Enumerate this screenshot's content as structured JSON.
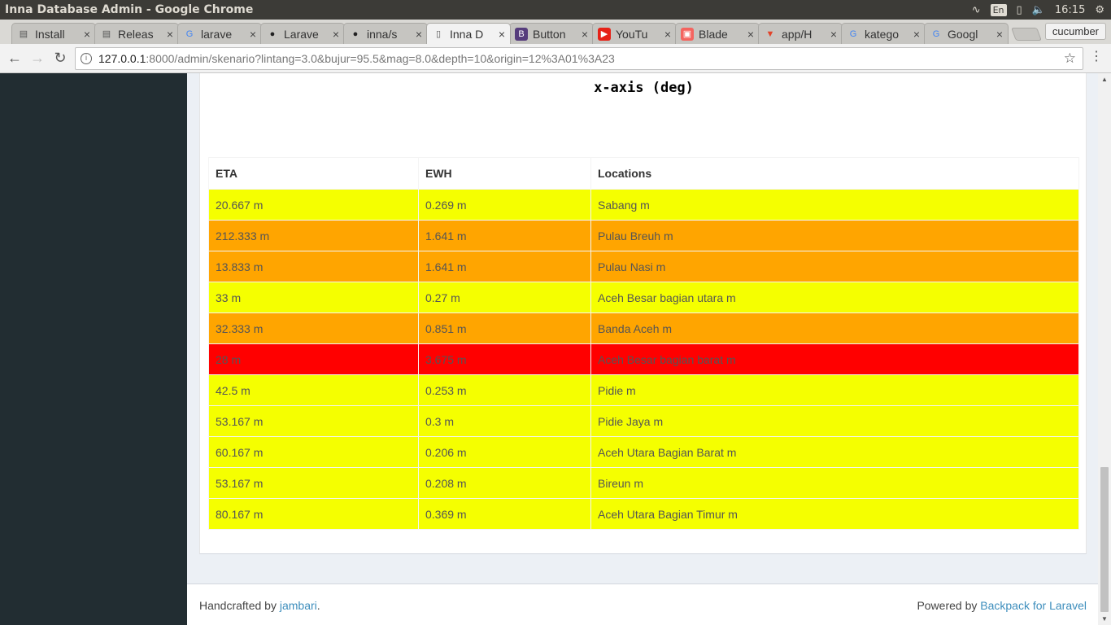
{
  "window": {
    "title": "Inna Database Admin - Google Chrome",
    "tray": {
      "lang": "En",
      "time": "16:15"
    }
  },
  "tabs": [
    {
      "label": "Install",
      "icon": "doc-icon",
      "active": false
    },
    {
      "label": "Releas",
      "icon": "doc-icon",
      "active": false
    },
    {
      "label": "larave",
      "icon": "google-icon",
      "active": false
    },
    {
      "label": "Larave",
      "icon": "github-icon",
      "active": false
    },
    {
      "label": "inna/s",
      "icon": "github-icon",
      "active": false
    },
    {
      "label": "Inna D",
      "icon": "page-icon",
      "active": true
    },
    {
      "label": "Button",
      "icon": "bootstrap-icon",
      "active": false
    },
    {
      "label": "YouTu",
      "icon": "youtube-icon",
      "active": false
    },
    {
      "label": "Blade",
      "icon": "laravel-icon",
      "active": false
    },
    {
      "label": "app/H",
      "icon": "gitlab-icon",
      "active": false
    },
    {
      "label": "katego",
      "icon": "google-icon",
      "active": false
    },
    {
      "label": "Googl",
      "icon": "google-icon",
      "active": false
    }
  ],
  "profile": "cucumber",
  "address": {
    "host": "127.0.0.1",
    "rest": ":8000/admin/skenario?lintang=3.0&bujur=95.5&mag=8.0&depth=10&origin=12%3A01%3A23"
  },
  "chart_data": {
    "type": "table",
    "xlabel": "x-axis (deg)",
    "columns": [
      "ETA",
      "EWH",
      "Locations"
    ],
    "rows": [
      {
        "eta": "20.667 m",
        "ewh": "0.269 m",
        "location": "Sabang m",
        "level": "yellow"
      },
      {
        "eta": "212.333 m",
        "ewh": "1.641 m",
        "location": "Pulau Breuh m",
        "level": "orange"
      },
      {
        "eta": "13.833 m",
        "ewh": "1.641 m",
        "location": "Pulau Nasi m",
        "level": "orange"
      },
      {
        "eta": "33 m",
        "ewh": "0.27 m",
        "location": "Aceh Besar bagian utara m",
        "level": "yellow"
      },
      {
        "eta": "32.333 m",
        "ewh": "0.851 m",
        "location": "Banda Aceh m",
        "level": "orange"
      },
      {
        "eta": "28 m",
        "ewh": "3.675 m",
        "location": "Aceh Besar bagian barat m",
        "level": "red"
      },
      {
        "eta": "42.5 m",
        "ewh": "0.253 m",
        "location": "Pidie m",
        "level": "yellow"
      },
      {
        "eta": "53.167 m",
        "ewh": "0.3 m",
        "location": "Pidie Jaya m",
        "level": "yellow"
      },
      {
        "eta": "60.167 m",
        "ewh": "0.206 m",
        "location": "Aceh Utara Bagian Barat m",
        "level": "yellow"
      },
      {
        "eta": "53.167 m",
        "ewh": "0.208 m",
        "location": "Bireun m",
        "level": "yellow"
      },
      {
        "eta": "80.167 m",
        "ewh": "0.369 m",
        "location": "Aceh Utara Bagian Timur m",
        "level": "yellow"
      }
    ]
  },
  "level_colors": {
    "yellow": "#f5ff00",
    "orange": "#ffa500",
    "red": "#ff0000"
  },
  "footer": {
    "left_text": "Handcrafted by ",
    "left_link": "jambari",
    "left_end": ".",
    "right_text": "Powered by ",
    "right_link": "Backpack for Laravel"
  }
}
